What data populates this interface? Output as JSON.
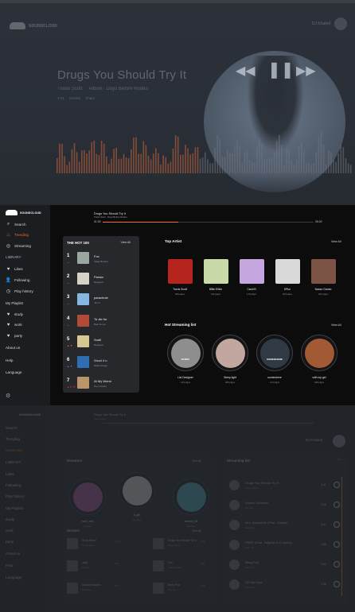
{
  "hero": {
    "brand": "SOUNDCLOUD",
    "user_name": "DJ Khaled",
    "title": "Drugs You Should Try It",
    "meta": [
      "Travis Scott",
      "Album : Days Before Rodeo"
    ],
    "meta2": [
      "4:41",
      "Stream",
      "Share"
    ],
    "controls": [
      "prev",
      "pause",
      "next"
    ]
  },
  "app": {
    "brand": "SOUNDCLOUD",
    "nav": [
      {
        "label": "Search",
        "icon": "search-icon"
      },
      {
        "label": "Trending",
        "icon": "fire-icon",
        "active": true
      },
      {
        "label": "Streaming",
        "icon": "stream-icon"
      }
    ],
    "library_label": "LIBRARY",
    "library": [
      {
        "label": "Likes",
        "icon": "heart-icon"
      },
      {
        "label": "Following",
        "icon": "user-icon"
      },
      {
        "label": "Play history",
        "icon": "history-icon"
      }
    ],
    "playlist_label": "My Playlist",
    "playlists": [
      {
        "label": "study",
        "icon": "heart-icon"
      },
      {
        "label": "work",
        "icon": "heart-icon"
      },
      {
        "label": "party",
        "icon": "heart-icon"
      }
    ],
    "footer_links": [
      "About us",
      "Help",
      "Language"
    ],
    "player": {
      "title": "Drugs You Should Try It",
      "subtitle": "Travis Scott · Days Before Rodeo",
      "elapsed": "01:30",
      "total": "05:20",
      "progress": 0.36
    },
    "hot100": {
      "header": "THE HOT 100",
      "view_all": "View All",
      "rows": [
        {
          "rank": "1",
          "trend": "—",
          "trend_color": "#f26f21",
          "title": "Fox",
          "artist": "Vitaly Bender",
          "cover": "#9aa6a0"
        },
        {
          "rank": "2",
          "trend": "—",
          "trend_color": "#f26f21",
          "title": "Panda",
          "artist": "Designer",
          "cover": "#d6d2c7"
        },
        {
          "rank": "3",
          "trend": "—",
          "trend_color": "#f26f21",
          "title": "parachute",
          "artist": "Jon K",
          "cover": "#86b7e2"
        },
        {
          "rank": "4",
          "trend": "—",
          "trend_color": "#f26f21",
          "title": "To die for",
          "artist": "Bad Jim lei",
          "cover": "#b24a3a"
        },
        {
          "rank": "5",
          "trend": "▲ ▼",
          "trend_color": "#f26f21",
          "title": "Snail",
          "artist": "Designer",
          "cover": "#d7c790"
        },
        {
          "rank": "6",
          "trend": "▲ ▼",
          "trend_color": "#4c8cd6",
          "title": "Good 4 u",
          "artist": "Ethel Gunga",
          "cover": "#2f6db5"
        },
        {
          "rank": "7",
          "trend": "▲▼ 19",
          "trend_color": "#e0342b",
          "title": "At My Worst",
          "artist": "Tom Oxwell",
          "cover": "#b9966a"
        }
      ]
    },
    "top_artist": {
      "header": "Top Artist",
      "view_all": "View All",
      "items": [
        {
          "name": "Travis Scott",
          "plays": "200 plays",
          "color": "#b5251e"
        },
        {
          "name": "Billie Eilish",
          "plays": "130 plays",
          "color": "#c9d9a7"
        },
        {
          "name": "Cardi B",
          "plays": "179 plays",
          "color": "#c6a6de"
        },
        {
          "name": "6Ptur",
          "plays": "163 plays",
          "color": "#d9d9d9"
        },
        {
          "name": "Nasso Gandu",
          "plays": "321 plays",
          "color": "#7b5446"
        }
      ]
    },
    "hot_streaming": {
      "header": "Hot Streaming list",
      "view_all": "View All",
      "items": [
        {
          "name": "Lisi Designer",
          "plays": "133 plays",
          "color": "#8e8e8e",
          "sub": "PANDA"
        },
        {
          "name": "Sleep light",
          "plays": "209 plays",
          "color": "#c2a7a0",
          "sub": ""
        },
        {
          "name": "somewhere",
          "plays": "173 plays",
          "color": "#2f3a45",
          "sub": "SOMEWHERE"
        },
        {
          "name": "with my girl",
          "plays": "349 plays",
          "color": "#a25a35",
          "sub": ""
        }
      ]
    }
  },
  "faded": {
    "brand": "SOUNDCLOUD",
    "player_title": "Drugs You Should Try It",
    "player_sub": "Travis Scott",
    "user_name": "DJ Khaled",
    "nav": [
      "Search",
      "Trending",
      "Streaming"
    ],
    "library_label": "LIBRARY",
    "library": [
      "Likes",
      "Following",
      "Play history"
    ],
    "playlist_label": "My Playlist",
    "playlists": [
      "study",
      "work",
      "party"
    ],
    "footer_links": [
      "About us",
      "Help",
      "Language"
    ],
    "panels": {
      "left_title": "Donation",
      "left_view": "View All",
      "right_title": "Streaming list",
      "albums": [
        {
          "name": "neon_rain",
          "plays": "44 plays",
          "color": "#a45aa0"
        },
        {
          "name": "it_girl",
          "plays": "32 plays",
          "color": "#d2d2d2"
        },
        {
          "name": "colorful_45",
          "plays": "28 plays",
          "color": "#4ca6b8"
        }
      ],
      "recent_title": "RECENT",
      "recent_view": "View All",
      "recent": [
        {
          "a": "Sicky Mood",
          "b": "Tom Dramon",
          "c": "1.4 m"
        },
        {
          "a": "Drugs You Should Try It",
          "b": "Travis Scott",
          "c": "4:41"
        },
        {
          "a": "Jade",
          "b": "Hu Ling",
          "c": "2:33"
        },
        {
          "a": "Fox",
          "b": "Vitaly Bender",
          "c": "3:21"
        },
        {
          "a": "Drama Kadabra",
          "b": "Ex Nova",
          "c": "1:47"
        },
        {
          "a": "Bang Pop",
          "b": "Kay Tom",
          "c": "2:59"
        }
      ],
      "stream_rows": [
        {
          "t1": "Drugs You Should Try It",
          "t2": "Travis Scott",
          "du": "4:41"
        },
        {
          "t1": "Kisses Goodbye",
          "t2": "Mo Gun",
          "du": "3:15"
        },
        {
          "t1": "Mrs. Wonderful (Feat. Cidade)",
          "t2": "Sam Ray",
          "du": "3:47"
        },
        {
          "t1": "FREE (Feat. Tollgeist & D-Jones)",
          "t2": "Dani Mo",
          "du": "2:58"
        },
        {
          "t1": "Bling Pop",
          "t2": "Kay Tom",
          "du": "3:02"
        },
        {
          "t1": "Off My Face",
          "t2": "Justin B",
          "du": "2:36"
        }
      ]
    }
  }
}
